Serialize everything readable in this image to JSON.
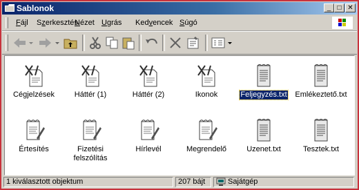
{
  "window": {
    "title": "Sablonok"
  },
  "menu": [
    {
      "pre": "",
      "u": "F",
      "post": "ájl"
    },
    {
      "pre": "S",
      "u": "z",
      "post": "erkesztés"
    },
    {
      "pre": "",
      "u": "N",
      "post": "ézet"
    },
    {
      "pre": "",
      "u": "U",
      "post": "grás"
    },
    {
      "pre": "Ked",
      "u": "v",
      "post": "encek"
    },
    {
      "pre": "",
      "u": "S",
      "post": "úgó"
    }
  ],
  "toolbar": {
    "back_icon": "back-arrow-icon",
    "forward_icon": "forward-arrow-icon",
    "up_icon": "up-folder-icon",
    "cut_icon": "cut-icon",
    "copy_icon": "copy-icon",
    "paste_icon": "paste-icon",
    "undo_icon": "undo-icon",
    "delete_icon": "delete-icon",
    "properties_icon": "properties-icon",
    "views_icon": "views-icon"
  },
  "files": [
    {
      "name": "Cégjelzések",
      "icon": "template-icon",
      "selected": false
    },
    {
      "name": "Háttér (1)",
      "icon": "template-icon",
      "selected": false
    },
    {
      "name": "Háttér (2)",
      "icon": "template-icon",
      "selected": false
    },
    {
      "name": "Ikonok",
      "icon": "template-icon",
      "selected": false
    },
    {
      "name": "Feljegyzés.txt",
      "icon": "text-file-icon",
      "selected": true
    },
    {
      "name": "Emlékeztető.txt",
      "icon": "text-file-icon",
      "selected": false
    },
    {
      "name": "Értesítés",
      "icon": "note-icon",
      "selected": false
    },
    {
      "name": "Fizetési felszólítás",
      "icon": "note-icon",
      "selected": false
    },
    {
      "name": "Hírlevél",
      "icon": "note-icon",
      "selected": false
    },
    {
      "name": "Megrendelő",
      "icon": "note-icon",
      "selected": false
    },
    {
      "name": "Uzenet.txt",
      "icon": "text-file-icon",
      "selected": false
    },
    {
      "name": "Tesztek.txt",
      "icon": "text-file-icon",
      "selected": false
    }
  ],
  "status": {
    "selection": "1 kiválasztott objektum",
    "size": "207 bájt",
    "location": "Sajátgép"
  },
  "colors": {
    "window_border": "#c8323c",
    "title_bar": "#0a246a",
    "selection": "#0a246a"
  }
}
